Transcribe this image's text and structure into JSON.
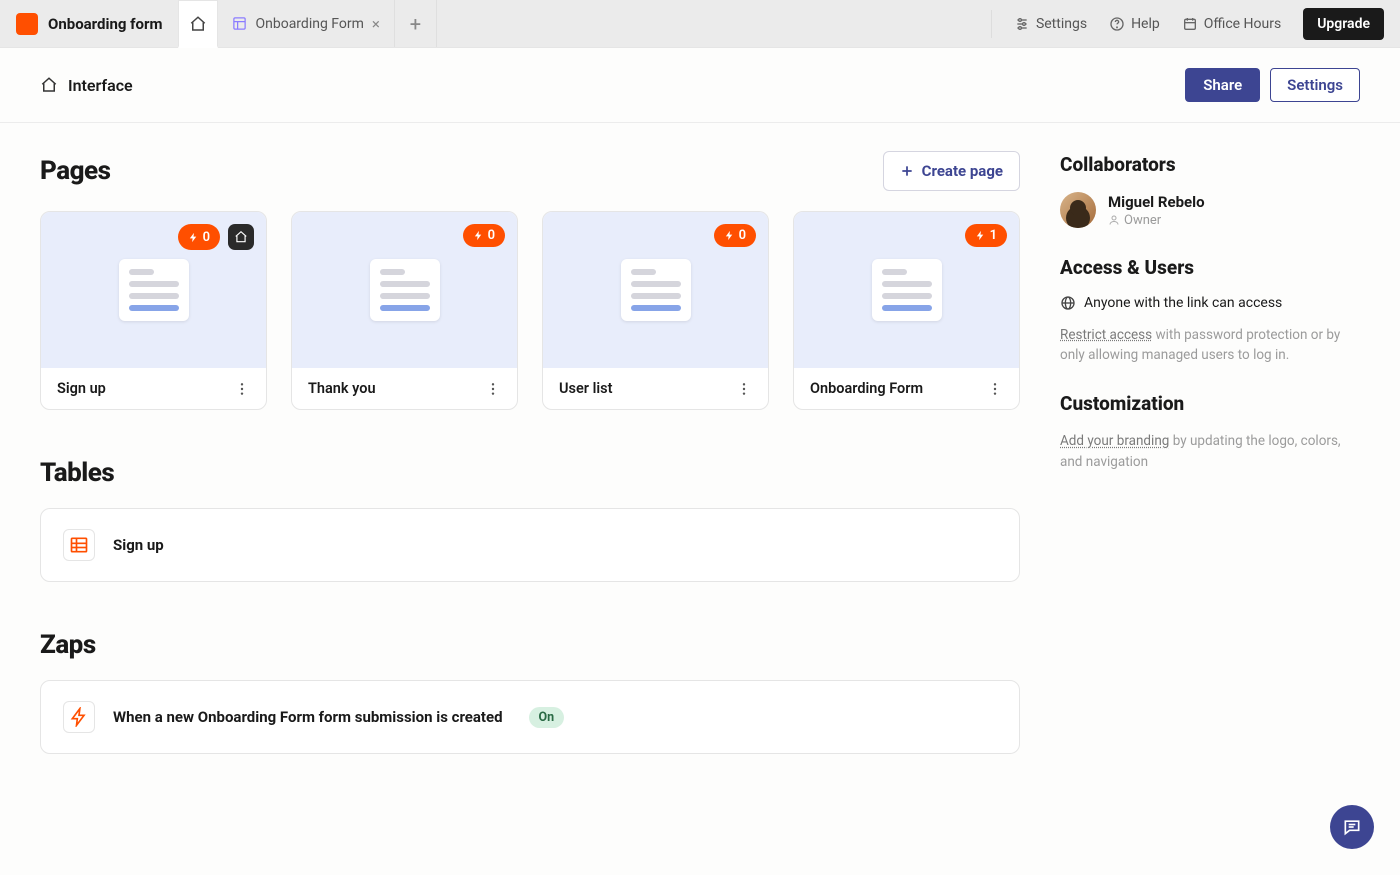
{
  "app": {
    "title": "Onboarding form"
  },
  "tabs": {
    "home_icon": "home",
    "open": {
      "icon": "layout",
      "label": "Onboarding Form"
    }
  },
  "header": {
    "settings": "Settings",
    "help": "Help",
    "office_hours": "Office Hours",
    "upgrade": "Upgrade"
  },
  "subheader": {
    "title": "Interface",
    "share": "Share",
    "settings": "Settings"
  },
  "pages": {
    "title": "Pages",
    "create_label": "Create page",
    "cards": [
      {
        "name": "Sign up",
        "count": "0",
        "is_home": true
      },
      {
        "name": "Thank you",
        "count": "0",
        "is_home": false
      },
      {
        "name": "User list",
        "count": "0",
        "is_home": false
      },
      {
        "name": "Onboarding Form",
        "count": "1",
        "is_home": false
      }
    ]
  },
  "tables": {
    "title": "Tables",
    "items": [
      {
        "name": "Sign up"
      }
    ]
  },
  "zaps": {
    "title": "Zaps",
    "items": [
      {
        "name": "When a new Onboarding Form form submission is created",
        "status": "On"
      }
    ]
  },
  "sidebar": {
    "collaborators_title": "Collaborators",
    "owner_name": "Miguel Rebelo",
    "owner_role": "Owner",
    "access_title": "Access & Users",
    "access_line": "Anyone with the link can access",
    "restrict_link": "Restrict access",
    "restrict_rest": " with password protection or by only allowing managed users to log in.",
    "custom_title": "Customization",
    "branding_link": "Add your branding",
    "branding_rest": " by updating the logo, colors, and navigation"
  }
}
